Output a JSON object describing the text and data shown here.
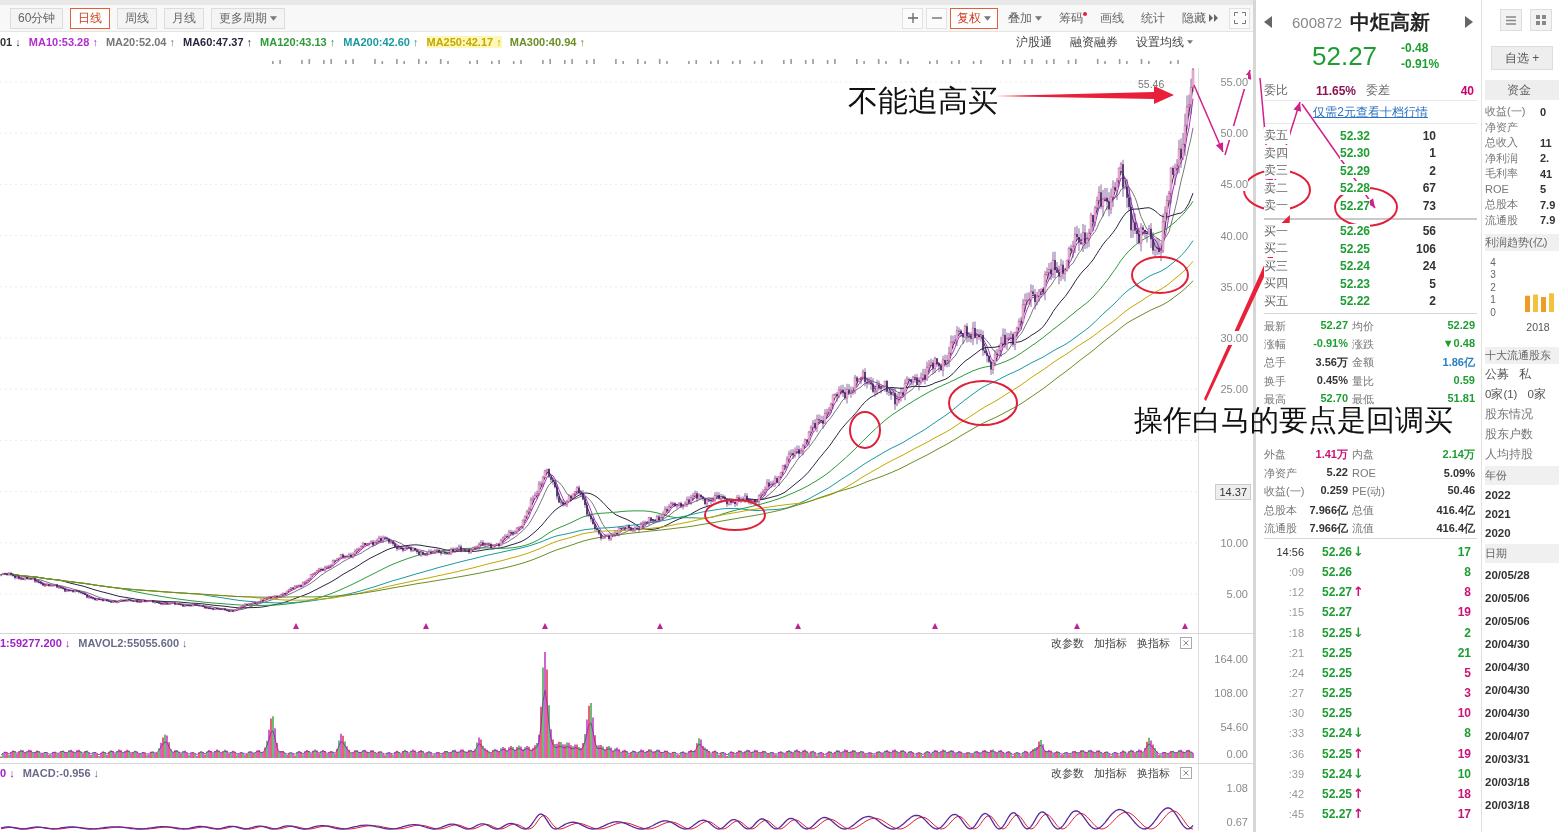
{
  "toolbar": {
    "tabs": [
      {
        "label": "60分钟",
        "selected": false,
        "kind": "plain"
      },
      {
        "label": "日线",
        "selected": true,
        "kind": "plain"
      },
      {
        "label": "周线",
        "selected": false,
        "kind": "plain"
      },
      {
        "label": "月线",
        "selected": false,
        "kind": "plain"
      },
      {
        "label": "更多周期",
        "selected": false,
        "kind": "dropdown"
      }
    ],
    "tools": [
      {
        "kind": "zoom_in",
        "active": false,
        "dot": false
      },
      {
        "kind": "zoom_out",
        "active": false,
        "dot": false
      },
      {
        "kind": "dropdown",
        "label": "复权",
        "active": true,
        "dot": false
      },
      {
        "kind": "dropdown",
        "label": "叠加",
        "active": false,
        "dot": false
      },
      {
        "kind": "plain",
        "label": "筹码",
        "active": false,
        "dot": true
      },
      {
        "kind": "plain",
        "label": "画线",
        "active": false,
        "dot": false
      },
      {
        "kind": "plain",
        "label": "统计",
        "active": false,
        "dot": false
      },
      {
        "kind": "collapse",
        "label": "隐藏",
        "active": false,
        "dot": false
      },
      {
        "kind": "fullscreen",
        "active": false,
        "dot": false
      }
    ]
  },
  "legend": [
    {
      "text": "01 ↓",
      "color": "#333333",
      "highlighted": false
    },
    {
      "text": "MA10:53.28 ↑",
      "color": "#b02ccf",
      "highlighted": false
    },
    {
      "text": "MA20:52.04 ↑",
      "color": "#777777",
      "highlighted": false
    },
    {
      "text": "MA60:47.37 ↑",
      "color": "#2a2440",
      "highlighted": false
    },
    {
      "text": "MA120:43.13 ↑",
      "color": "#2e9a3a",
      "highlighted": false
    },
    {
      "text": "MA200:42.60 ↑",
      "color": "#1a9aa0",
      "highlighted": false
    },
    {
      "text": "MA250:42.17 ↑",
      "color": "#c2a800",
      "highlighted": true
    },
    {
      "text": "MA300:40.94 ↑",
      "color": "#6b8e23",
      "highlighted": false
    }
  ],
  "chart_links": [
    {
      "label": "沪股通",
      "kind": "plain"
    },
    {
      "label": "融资融券",
      "kind": "plain"
    },
    {
      "label": "设置均线",
      "kind": "dropdown"
    }
  ],
  "price_chart": {
    "high_label": "55.46",
    "axis": [
      "55.00",
      "50.00",
      "45.00",
      "40.00",
      "35.00",
      "30.00",
      "25.00",
      "10.00",
      "5.00"
    ],
    "cursor": "14.37"
  },
  "annotations": [
    "不能追高买",
    "操作白马的要点是回调买"
  ],
  "volume_panel": {
    "legend": [
      {
        "text": "1:59277.200 ↓",
        "color": "#a020c8"
      },
      {
        "text": "MAVOL2:55055.600 ↓",
        "color": "#6a6a8a"
      }
    ],
    "tools": [
      "改参数",
      "加指标",
      "换指标"
    ],
    "axis": [
      "164.00",
      "108.00",
      "54.60",
      "0.00"
    ]
  },
  "macd_panel": {
    "legend": [
      {
        "text": "0 ↓",
        "color": "#a020c8"
      },
      {
        "text": "MACD:-0.956 ↓",
        "color": "#6a6a8a"
      }
    ],
    "tools": [
      "改参数",
      "加指标",
      "换指标"
    ],
    "axis": [
      "1.08",
      "0.67"
    ]
  },
  "quote": {
    "code": "600872",
    "name": "中炬高新",
    "price": "52.27",
    "change": "-0.48",
    "change_pct": "-0.91%"
  },
  "order_book": {
    "ratio_label": "委比",
    "ratio": "11.65%",
    "diff_label": "委差",
    "diff": "40",
    "link": "仅需2元查看十档行情",
    "sell": [
      {
        "label": "卖五",
        "price": "52.32",
        "volume": "10"
      },
      {
        "label": "卖四",
        "price": "52.30",
        "volume": "1"
      },
      {
        "label": "卖三",
        "price": "52.29",
        "volume": "2"
      },
      {
        "label": "卖二",
        "price": "52.28",
        "volume": "67"
      },
      {
        "label": "卖一",
        "price": "52.27",
        "volume": "73"
      }
    ],
    "buy": [
      {
        "label": "买一",
        "price": "52.26",
        "volume": "56"
      },
      {
        "label": "买二",
        "price": "52.25",
        "volume": "106"
      },
      {
        "label": "买三",
        "price": "52.24",
        "volume": "24"
      },
      {
        "label": "买四",
        "price": "52.23",
        "volume": "5"
      },
      {
        "label": "买五",
        "price": "52.22",
        "volume": "2"
      }
    ]
  },
  "stats_top": [
    {
      "left": {
        "label": "最新",
        "value": "52.27",
        "color": "#1e9e32"
      },
      "right": {
        "label": "均价",
        "value": "52.29",
        "color": "#1e9e32"
      }
    },
    {
      "left": {
        "label": "涨幅",
        "value": "-0.91%",
        "color": "#1e9e32"
      },
      "right": {
        "label": "涨跌",
        "value": "▼0.48",
        "color": "#1e9e32"
      }
    },
    {
      "left": {
        "label": "总手",
        "value": "3.56万",
        "color": "#333333"
      },
      "right": {
        "label": "金额",
        "value": "1.86亿",
        "color": "#2a7fc0"
      }
    },
    {
      "left": {
        "label": "换手",
        "value": "0.45%",
        "color": "#333333"
      },
      "right": {
        "label": "量比",
        "value": "0.59",
        "color": "#1e9e32"
      }
    },
    {
      "left": {
        "label": "最高",
        "value": "52.70",
        "color": "#1e9e32"
      },
      "right": {
        "label": "最低",
        "value": "51.81",
        "color": "#1e9e32"
      }
    }
  ],
  "stats_bottom": [
    {
      "left": {
        "label": "外盘",
        "value": "1.41万",
        "color": "#c81478"
      },
      "right": {
        "label": "内盘",
        "value": "2.14万",
        "color": "#1e9e32"
      }
    },
    {
      "left": {
        "label": "净资产",
        "value": "5.22",
        "color": "#333333"
      },
      "right": {
        "label": "ROE",
        "value": "5.09%",
        "color": "#333333"
      }
    },
    {
      "left": {
        "label": "收益(一)",
        "value": "0.259",
        "color": "#333333"
      },
      "right": {
        "label": "PE(动)",
        "value": "50.46",
        "color": "#333333"
      }
    },
    {
      "left": {
        "label": "总股本",
        "value": "7.966亿",
        "color": "#333333"
      },
      "right": {
        "label": "总值",
        "value": "416.4亿",
        "color": "#333333"
      }
    },
    {
      "left": {
        "label": "流通股",
        "value": "7.966亿",
        "color": "#333333"
      },
      "right": {
        "label": "流值",
        "value": "416.4亿",
        "color": "#333333"
      }
    }
  ],
  "ticks": [
    {
      "time": "14:56",
      "price": "52.26",
      "arrow": "↓",
      "volume": "17",
      "color": "#1e9e32"
    },
    {
      "time": ":09",
      "price": "52.26",
      "volume": "8",
      "color": "#1e9e32"
    },
    {
      "time": ":12",
      "price": "52.27",
      "arrow": "↑",
      "volume": "8",
      "color": "#c81478"
    },
    {
      "time": ":15",
      "price": "52.27",
      "volume": "19",
      "color": "#c81478"
    },
    {
      "time": ":18",
      "price": "52.25",
      "arrow": "↓",
      "volume": "2",
      "color": "#1e9e32"
    },
    {
      "time": ":21",
      "price": "52.25",
      "volume": "21",
      "color": "#1e9e32"
    },
    {
      "time": ":24",
      "price": "52.25",
      "volume": "5",
      "color": "#c81478"
    },
    {
      "time": ":27",
      "price": "52.25",
      "volume": "3",
      "color": "#c81478"
    },
    {
      "time": ":30",
      "price": "52.25",
      "volume": "10",
      "color": "#c81478"
    },
    {
      "time": ":33",
      "price": "52.24",
      "arrow": "↓",
      "volume": "8",
      "color": "#1e9e32"
    },
    {
      "time": ":36",
      "price": "52.25",
      "arrow": "↑",
      "volume": "19",
      "color": "#c81478"
    },
    {
      "time": ":39",
      "price": "52.24",
      "arrow": "↓",
      "volume": "10",
      "color": "#1e9e32"
    },
    {
      "time": ":42",
      "price": "52.25",
      "arrow": "↑",
      "volume": "18",
      "color": "#c81478"
    },
    {
      "time": ":45",
      "price": "52.27",
      "arrow": "↑",
      "volume": "17",
      "color": "#c81478"
    }
  ],
  "side_panel": {
    "watch_button": "自选 +",
    "tab": "资金",
    "profile": [
      {
        "label": "收益(一)",
        "value": "0"
      },
      {
        "label": "净资产"
      },
      {
        "label": "总收入",
        "value": "11"
      },
      {
        "label": "净利润",
        "value": "2."
      },
      {
        "label": "毛利率",
        "value": "41"
      },
      {
        "label": "ROE",
        "value": "5"
      },
      {
        "label": "总股本",
        "value": "7.9"
      },
      {
        "label": "流通股",
        "value": "7.9"
      }
    ],
    "profit_title": "利润趋势(亿)",
    "chart_data": {
      "type": "bar",
      "categories": [
        "2018"
      ],
      "ylim": [
        0,
        4
      ],
      "yticks": [
        0,
        1,
        2,
        3,
        4
      ],
      "series": [
        {
          "color": "#f09a28",
          "values": [
            1.3
          ]
        },
        {
          "color": "#f5c040",
          "values": [
            1.4
          ]
        },
        {
          "color": "#f09a28",
          "values": [
            1.2
          ]
        },
        {
          "color": "#f5c040",
          "values": [
            1.5
          ]
        }
      ]
    },
    "holders_title": "十大流通股东",
    "holder_types": [
      "公募",
      "私"
    ],
    "holder_counts": [
      "0家(1)",
      "0家"
    ],
    "links": [
      "股东情况",
      "股东户数",
      "人均持股"
    ],
    "year_header": "年份",
    "years": [
      "2022",
      "2021",
      "2020"
    ],
    "date_header": "日期",
    "dates": [
      "20/05/28",
      "20/05/06",
      "20/05/06",
      "20/04/30",
      "20/04/30",
      "20/04/30",
      "20/04/30",
      "20/04/07",
      "20/03/31",
      "20/03/18",
      "20/03/18"
    ]
  }
}
